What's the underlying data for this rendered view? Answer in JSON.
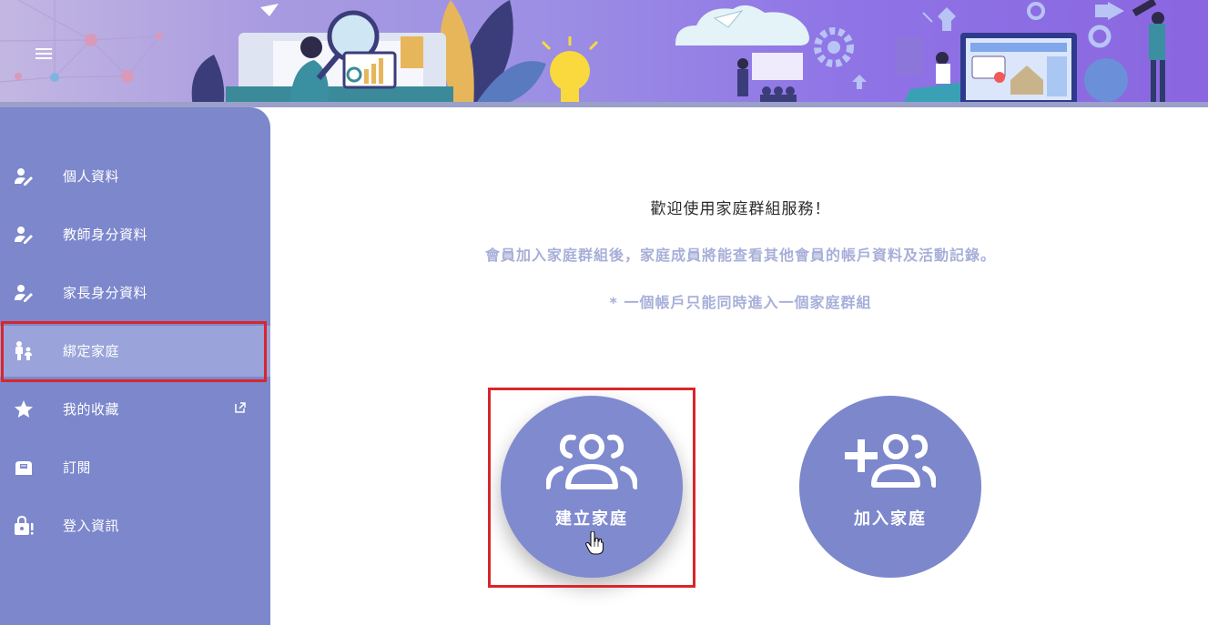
{
  "header": {
    "menu_icon": "hamburger-menu-icon"
  },
  "sidebar": {
    "items": [
      {
        "label": "個人資料",
        "icon": "user-edit-icon"
      },
      {
        "label": "教師身分資料",
        "icon": "user-edit-icon"
      },
      {
        "label": "家長身分資料",
        "icon": "user-edit-icon"
      },
      {
        "label": "綁定家庭",
        "icon": "parent-child-icon",
        "active": true
      },
      {
        "label": "我的收藏",
        "icon": "star-icon",
        "external": true
      },
      {
        "label": "訂閱",
        "icon": "mailbox-icon"
      },
      {
        "label": "登入資訊",
        "icon": "lock-alert-icon"
      }
    ]
  },
  "main": {
    "welcome": "歡迎使用家庭群組服務！",
    "description": "會員加入家庭群組後，家庭成員將能查看其他會員的帳戶資料及活動記錄。",
    "note": "* 一個帳戶只能同時進入一個家庭群組",
    "create_button": {
      "label": "建立家庭",
      "icon": "group-icon"
    },
    "join_button": {
      "label": "加入家庭",
      "icon": "add-user-icon"
    }
  },
  "colors": {
    "sidebar": "#7c87cc",
    "active_item": "#9aa4da",
    "highlight": "#d8262b",
    "muted_text": "#a7afd9"
  }
}
